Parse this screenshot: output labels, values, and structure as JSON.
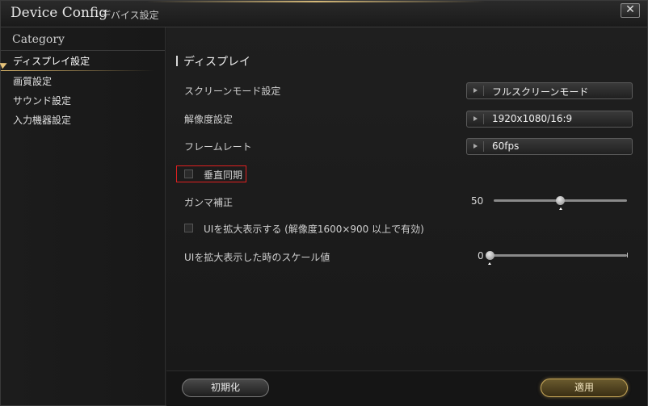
{
  "window": {
    "title": "Device Config",
    "subtitle": "デバイス設定",
    "close_label": "✕"
  },
  "sidebar": {
    "heading": "Category",
    "items": [
      {
        "label": "ディスプレイ設定",
        "active": true
      },
      {
        "label": "画質設定",
        "active": false
      },
      {
        "label": "サウンド設定",
        "active": false
      },
      {
        "label": "入力機器設定",
        "active": false
      }
    ]
  },
  "main": {
    "section_title": "ディスプレイ",
    "screen_mode": {
      "label": "スクリーンモード設定",
      "value": "フルスクリーンモード"
    },
    "resolution": {
      "label": "解像度設定",
      "value": "1920x1080/16:9"
    },
    "frame_rate": {
      "label": "フレームレート",
      "value": "60fps"
    },
    "vsync": {
      "label": "垂直同期",
      "checked": false
    },
    "gamma": {
      "label": "ガンマ補正",
      "value": "50",
      "fraction": 0.5
    },
    "ui_scale_enable": {
      "label": "UIを拡大表示する (解像度1600×900 以上で有効)",
      "checked": false
    },
    "ui_scale_value": {
      "label": "UIを拡大表示した時のスケール値",
      "value": "0",
      "fraction": 0
    }
  },
  "footer": {
    "reset_label": "初期化",
    "apply_label": "適用"
  },
  "colors": {
    "accent_gold": "#d9b56a",
    "highlight_red": "#e02020"
  }
}
